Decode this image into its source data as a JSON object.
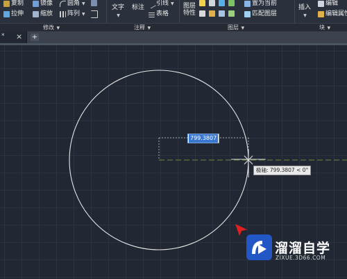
{
  "ribbon": {
    "modify": {
      "copy": "复制",
      "mirror": "镜像",
      "fillet": "圆角",
      "stretch": "拉伸",
      "scale": "缩放",
      "array": "阵列",
      "panel": "修改"
    },
    "annotation": {
      "text": "文字",
      "dimension": "标注",
      "leader": "引线",
      "table": "表格",
      "panel": "注释"
    },
    "layers": {
      "layer_properties": "图层\n特性",
      "set_current": "置为当前",
      "match_layer": "匹配图层",
      "panel": "图层"
    },
    "block": {
      "insert": "插入",
      "edit": "编辑",
      "edit_attributes": "编辑属性",
      "panel": "块"
    }
  },
  "tabs": {
    "current_marker": "*",
    "close_symbol": "×",
    "add_symbol": "+"
  },
  "drawing": {
    "dynamic_input_value": "799.3807",
    "polar_tooltip": "极轴: 799.3807 < 0°"
  },
  "watermark": {
    "title": "溜溜自学",
    "url": "ZIXUE.3D66.COM"
  },
  "colors": {
    "canvas_bg": "#222833",
    "ribbon_bg": "#2b313c",
    "circle_stroke": "#e6e6e6",
    "tracking_line": "#6b8a3a",
    "input_highlight": "#3a78d0",
    "cursor_red": "#e02020",
    "watermark_blue": "#2357c6"
  }
}
